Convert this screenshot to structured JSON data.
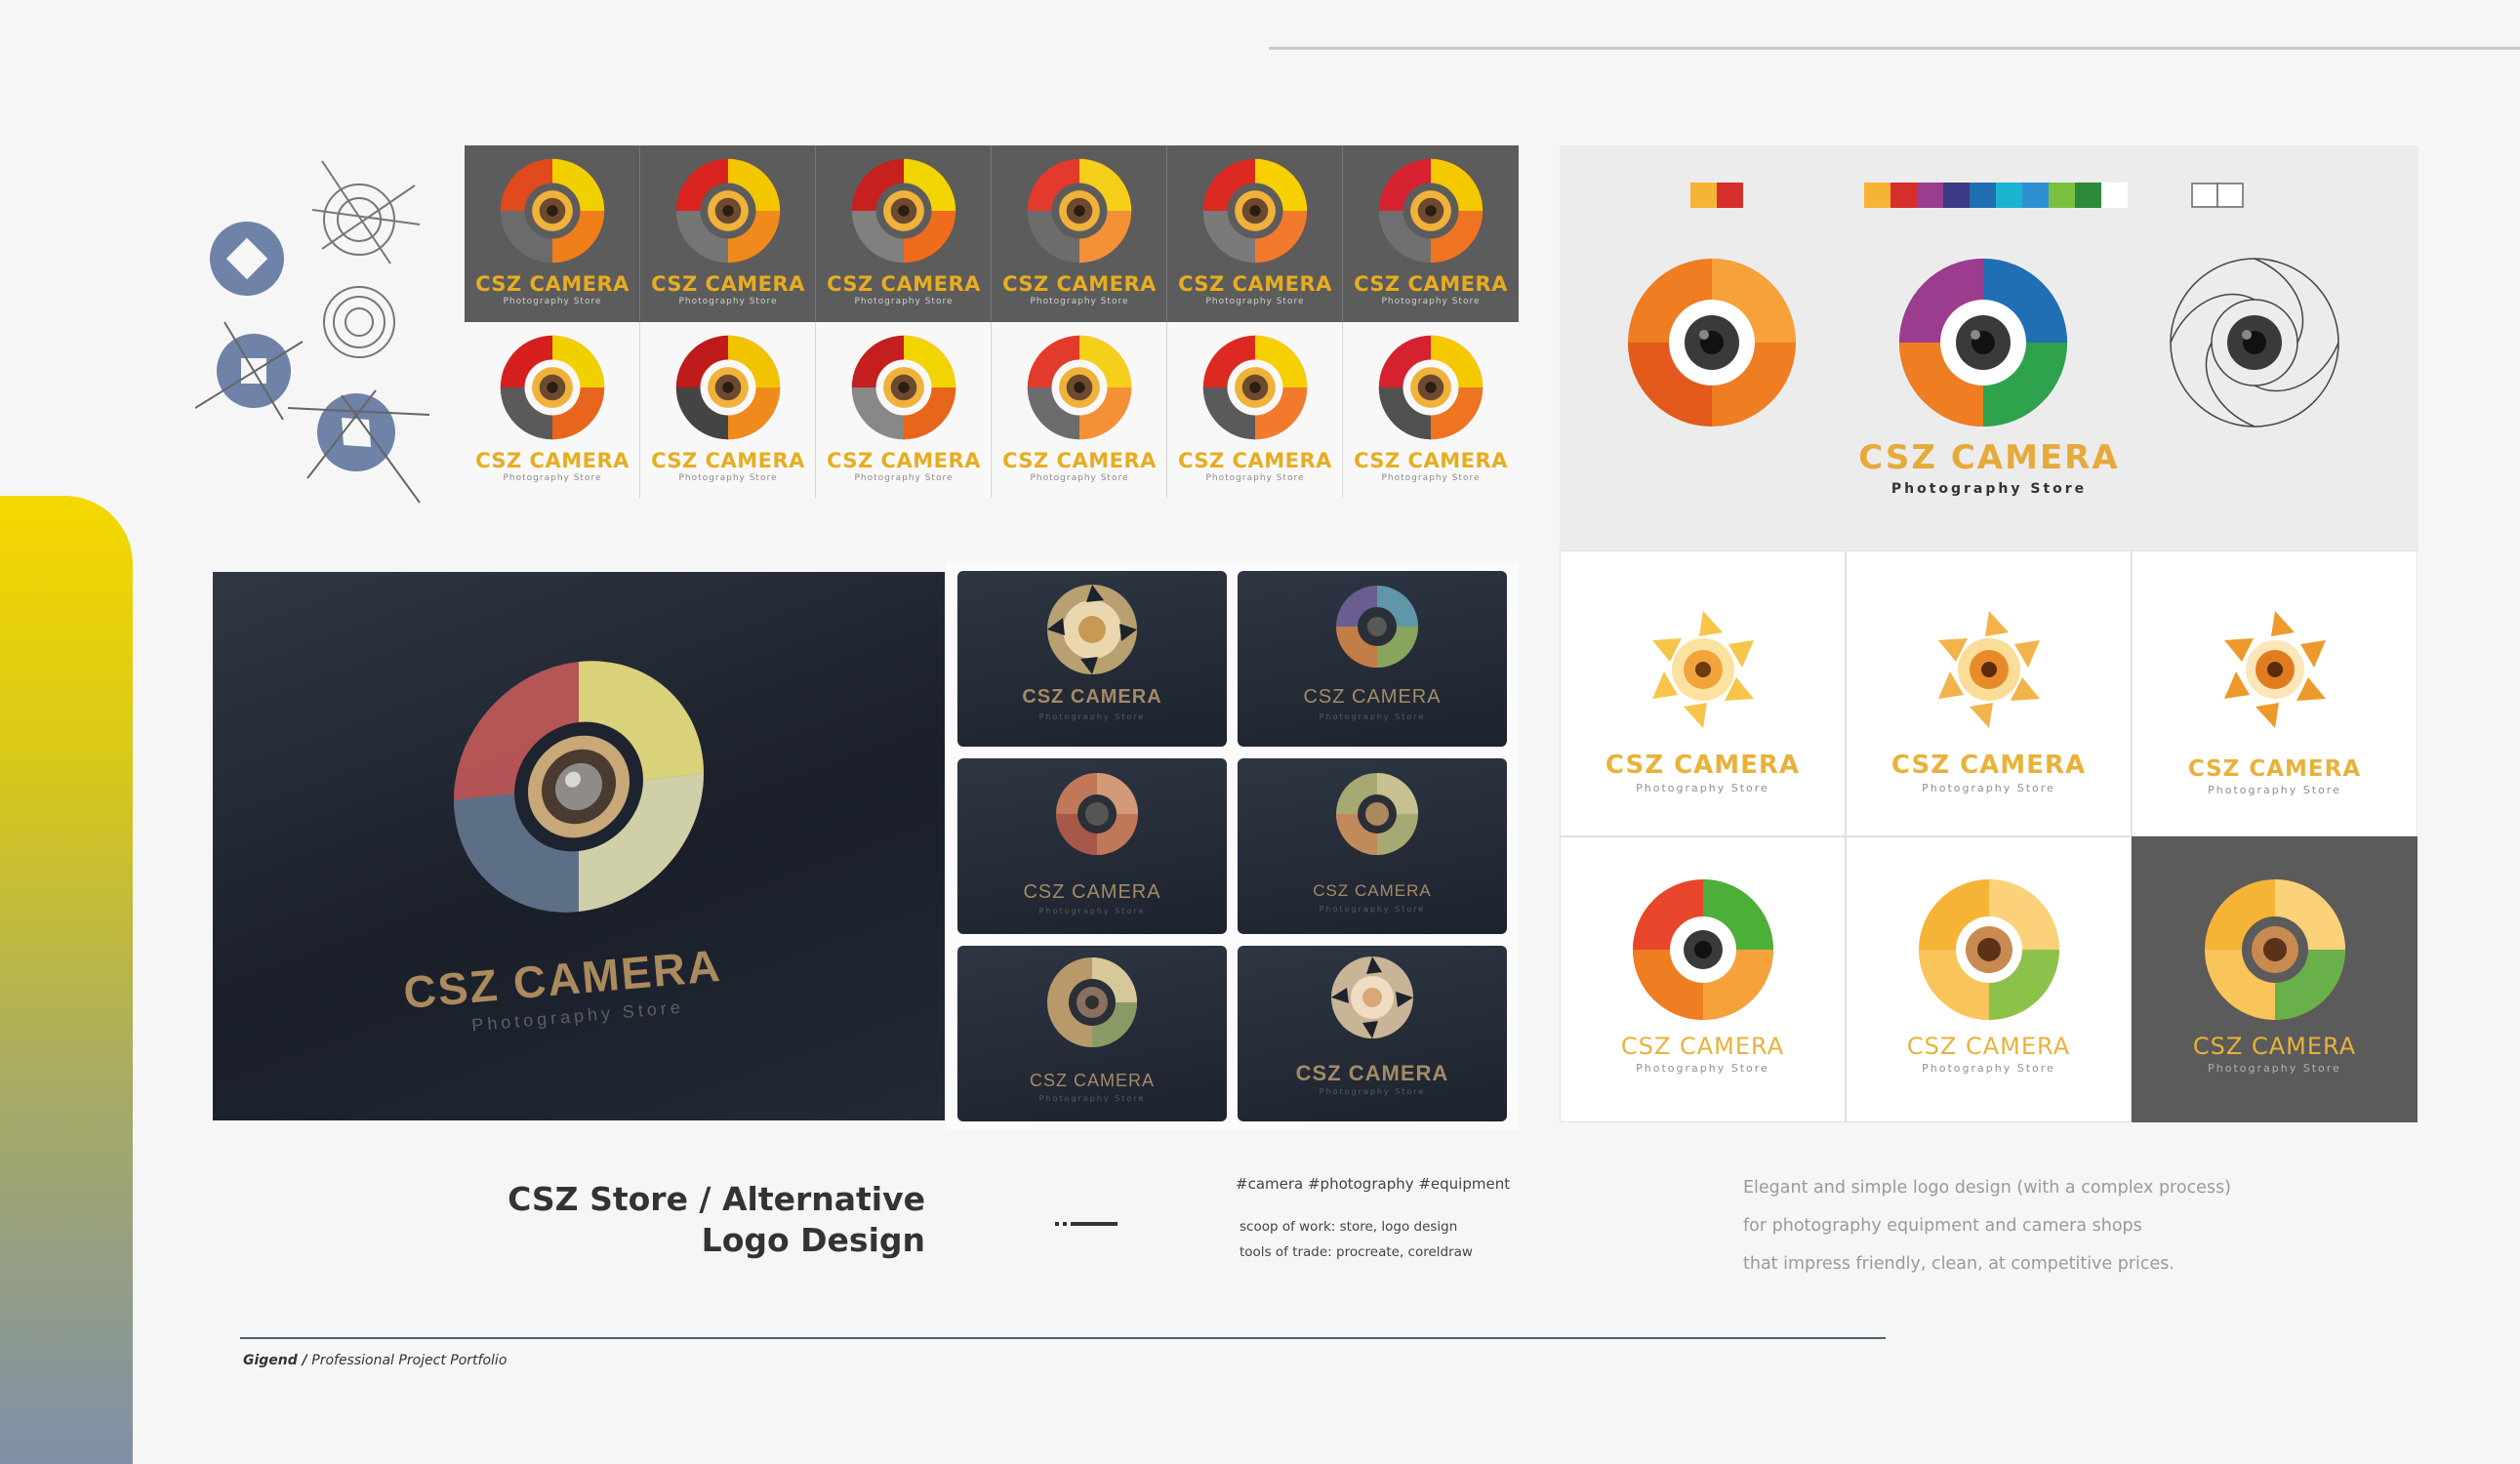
{
  "brand": {
    "name": "CSZ CAMERA",
    "tagline": "Photography Store"
  },
  "project": {
    "title_line1": "CSZ Store / Alternative",
    "title_line2": "Logo Design",
    "hashtags": "#camera #photography #equipment",
    "scope": "scoop of work: store, logo design",
    "tools": "tools of trade: procreate, coreldraw"
  },
  "description": {
    "line1": "Elegant and simple logo design (with a complex process)",
    "line2": "for photography equipment and camera shops",
    "line3": "that impress friendly, clean, at competitive prices."
  },
  "footer": {
    "author": "Gigend /",
    "label": "Professional Project Portfolio"
  },
  "palette": {
    "accent_yellow": "#f1d30a",
    "logo_yellow": "#f2c12e",
    "logo_orange": "#ef7d22",
    "logo_red": "#d8231f",
    "dark_panel": "#5d5c5c",
    "mockup_bg": "#1f2530"
  },
  "swatches": {
    "primary": [
      "#f6b436",
      "#d62f2b"
    ],
    "rainbow": [
      "#f6b436",
      "#d62f2b",
      "#9b3c8f",
      "#3b3a86",
      "#1f6fb2",
      "#1bb3d2",
      "#2ea24d",
      "#7ac142",
      "#2d8a3c"
    ],
    "outline": [
      "#ffffff",
      "#ffffff"
    ]
  }
}
